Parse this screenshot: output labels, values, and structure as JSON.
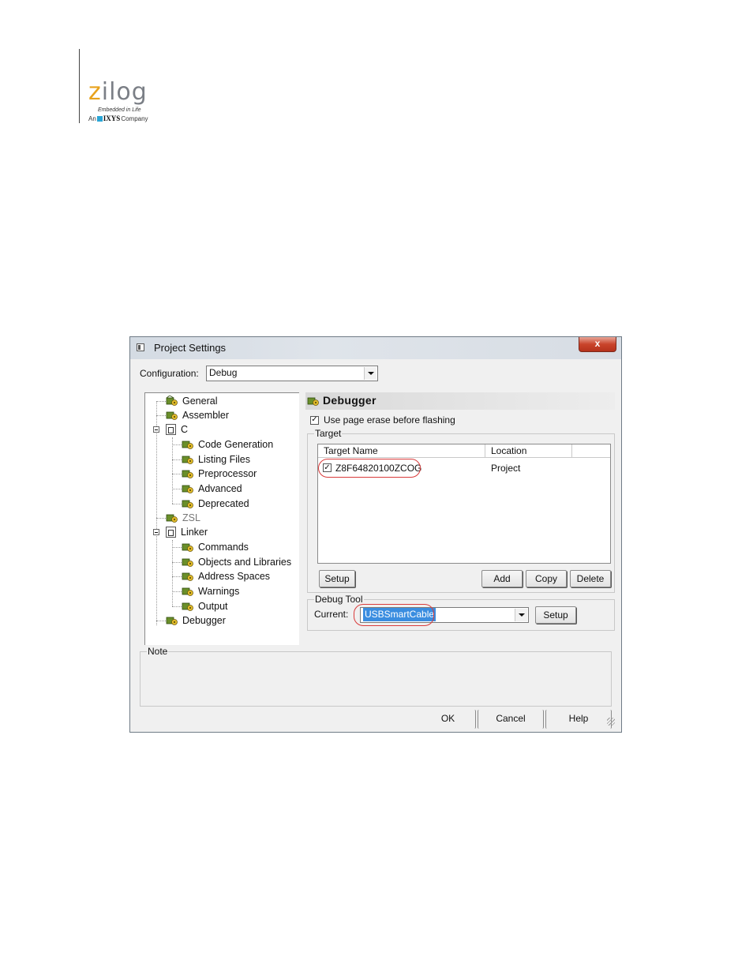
{
  "logo": {
    "wordmark_z": "z",
    "wordmark_rest": "ilog",
    "tagline": "Embedded in Life",
    "company_prefix": "An",
    "company_name": "IXYS",
    "company_suffix": "Company",
    "colors": {
      "z": "#e8a21c",
      "wordmark": "#7b7f86",
      "ixys": "#2aa6d6"
    }
  },
  "dialog": {
    "title": "Project Settings",
    "close_label": "x",
    "configuration": {
      "label": "Configuration:",
      "value": "Debug"
    },
    "tree": [
      {
        "label": "General",
        "level": 0,
        "type": "item"
      },
      {
        "label": "Assembler",
        "level": 0,
        "type": "item"
      },
      {
        "label": "C",
        "level": 0,
        "type": "folder"
      },
      {
        "label": "Code Generation",
        "level": 1,
        "type": "item"
      },
      {
        "label": "Listing Files",
        "level": 1,
        "type": "item"
      },
      {
        "label": "Preprocessor",
        "level": 1,
        "type": "item"
      },
      {
        "label": "Advanced",
        "level": 1,
        "type": "item"
      },
      {
        "label": "Deprecated",
        "level": 1,
        "type": "item"
      },
      {
        "label": "ZSL",
        "level": 0,
        "type": "item",
        "disabled": true
      },
      {
        "label": "Linker",
        "level": 0,
        "type": "folder"
      },
      {
        "label": "Commands",
        "level": 1,
        "type": "item"
      },
      {
        "label": "Objects and Libraries",
        "level": 1,
        "type": "item"
      },
      {
        "label": "Address Spaces",
        "level": 1,
        "type": "item"
      },
      {
        "label": "Warnings",
        "level": 1,
        "type": "item"
      },
      {
        "label": "Output",
        "level": 1,
        "type": "item"
      },
      {
        "label": "Debugger",
        "level": 0,
        "type": "item"
      }
    ],
    "panel": {
      "title": "Debugger",
      "page_erase": {
        "label": "Use page erase before flashing",
        "checked": true
      },
      "target": {
        "group_label": "Target",
        "columns": [
          "Target Name",
          "Location"
        ],
        "rows": [
          {
            "name": "Z8F64820100ZCOG",
            "location": "Project",
            "checked": true
          }
        ],
        "buttons": {
          "setup": "Setup",
          "add": "Add",
          "copy": "Copy",
          "delete": "Delete"
        }
      },
      "debug_tool": {
        "group_label": "Debug Tool",
        "current_label": "Current:",
        "current_value": "USBSmartCable",
        "setup": "Setup"
      }
    },
    "note_label": "Note",
    "buttons": {
      "ok": "OK",
      "cancel": "Cancel",
      "help": "Help"
    },
    "highlight_color": "#d93a3a"
  }
}
